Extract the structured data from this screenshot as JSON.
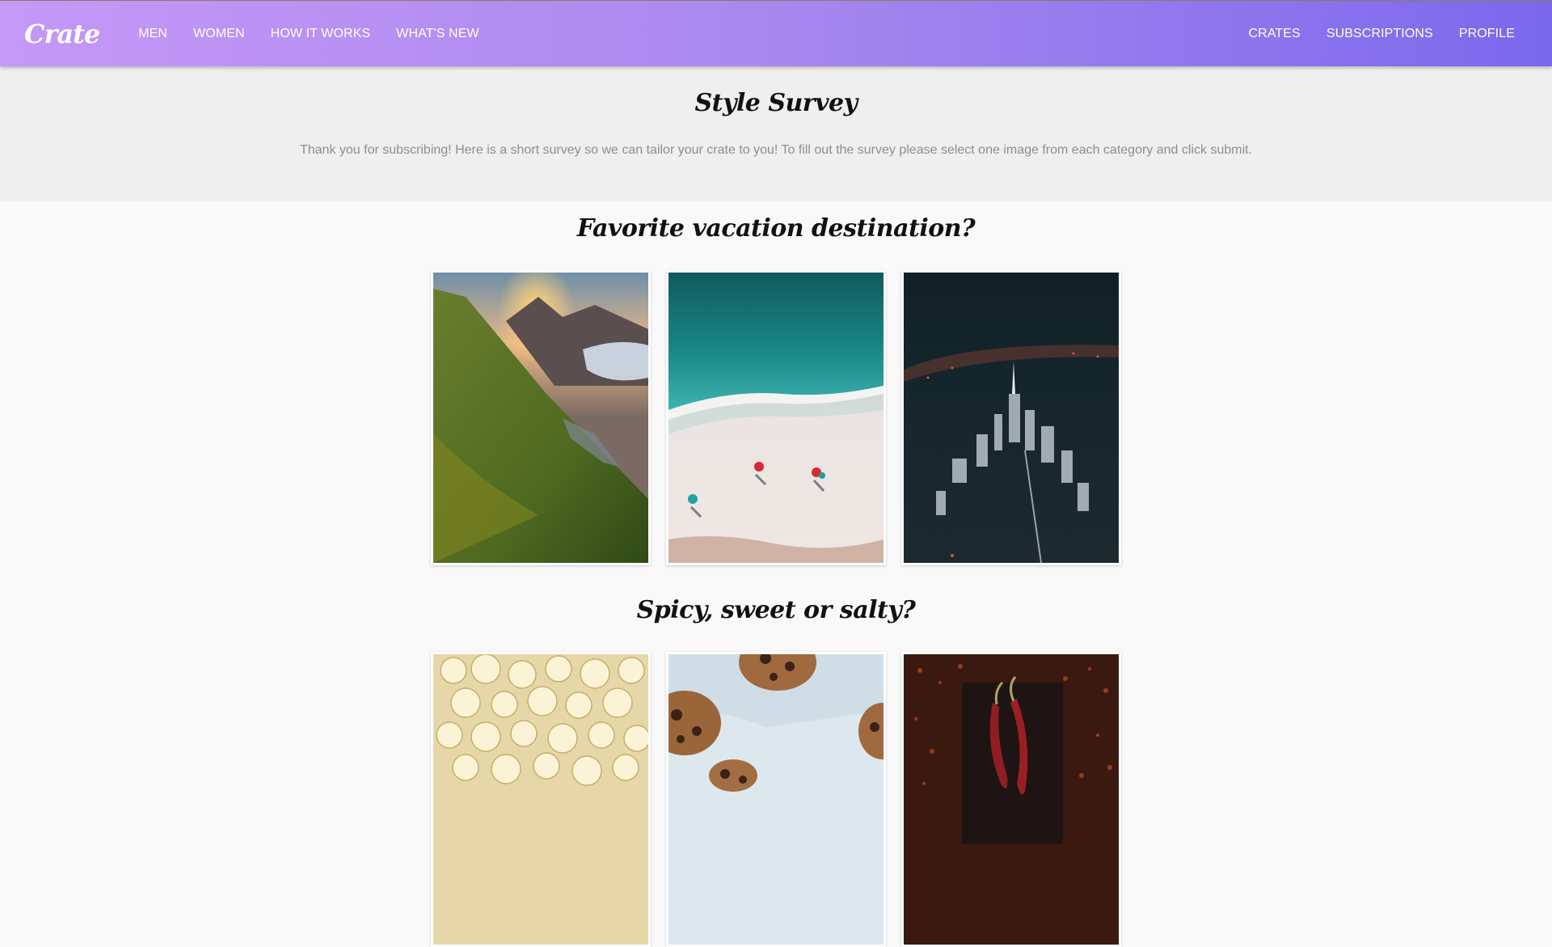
{
  "nav": {
    "logo": "Crate",
    "left_links": [
      "MEN",
      "WOMEN",
      "HOW IT WORKS",
      "WHAT'S NEW"
    ],
    "right_links": [
      "CRATES",
      "SUBSCRIPTIONS",
      "PROFILE"
    ]
  },
  "hero": {
    "title": "Style Survey",
    "subtitle": "Thank you for subscribing! Here is a short survey so we can tailor your crate to you! To fill out the survey please select one image from each category and click submit."
  },
  "sections": [
    {
      "title": "Favorite vacation destination?",
      "options": [
        "mountain-sunset-image",
        "beach-aerial-image",
        "city-night-image"
      ]
    },
    {
      "title": "Spicy, sweet or salty?",
      "options": [
        "popcorn-image",
        "cookies-image",
        "chili-peppers-image"
      ]
    }
  ],
  "colors": {
    "nav_gradient_start": "#c598f6",
    "nav_gradient_end": "#7b68ec"
  }
}
